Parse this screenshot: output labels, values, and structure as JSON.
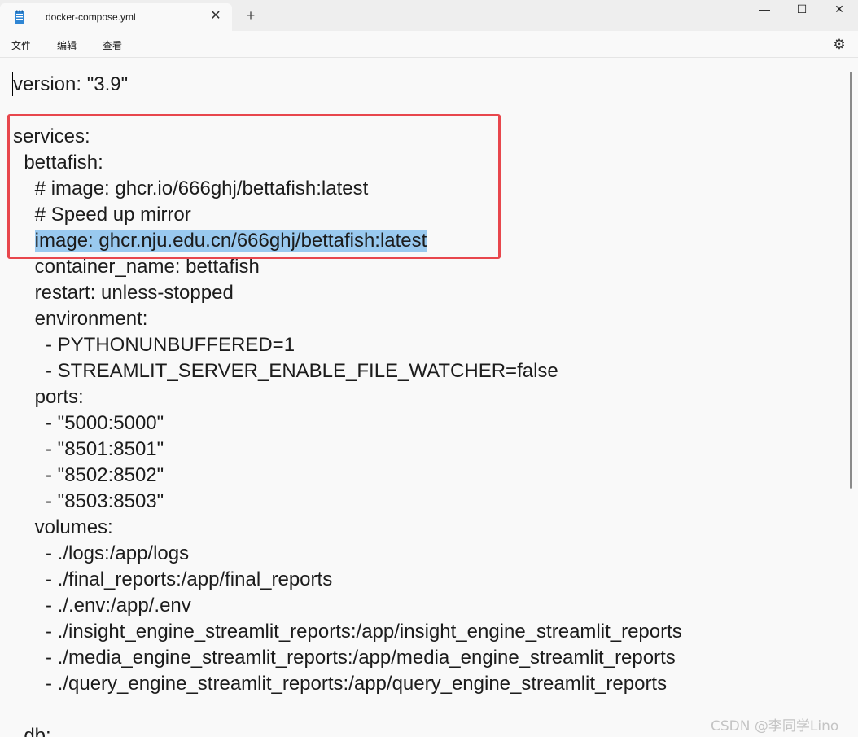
{
  "tab": {
    "title": "docker-compose.yml",
    "close_glyph": "✕",
    "new_glyph": "+"
  },
  "window": {
    "minimize_glyph": "—",
    "maximize_glyph": "☐",
    "close_glyph": "✕"
  },
  "menu": {
    "file": "文件",
    "edit": "编辑",
    "view": "查看",
    "settings_glyph": "⚙"
  },
  "editor": {
    "lines": [
      "version: \"3.9\"",
      "",
      "services:",
      "  bettafish:",
      "    # image: ghcr.io/666ghj/bettafish:latest",
      "    # Speed up mirror",
      "    image: ghcr.nju.edu.cn/666ghj/bettafish:latest",
      "    container_name: bettafish",
      "    restart: unless-stopped",
      "    environment:",
      "      - PYTHONUNBUFFERED=1",
      "      - STREAMLIT_SERVER_ENABLE_FILE_WATCHER=false",
      "    ports:",
      "      - \"5000:5000\"",
      "      - \"8501:8501\"",
      "      - \"8502:8502\"",
      "      - \"8503:8503\"",
      "    volumes:",
      "      - ./logs:/app/logs",
      "      - ./final_reports:/app/final_reports",
      "      - ./.env:/app/.env",
      "      - ./insight_engine_streamlit_reports:/app/insight_engine_streamlit_reports",
      "      - ./media_engine_streamlit_reports:/app/media_engine_streamlit_reports",
      "      - ./query_engine_streamlit_reports:/app/query_engine_streamlit_reports",
      "",
      "  db:"
    ],
    "selected_text": "image: ghcr.nju.edu.cn/666ghj/bettafish:latest"
  },
  "watermark": "CSDN @李同学Lino",
  "colors": {
    "selection": "#99c9ef",
    "annotation_box": "#e8474d",
    "background": "#f9f9f9"
  }
}
